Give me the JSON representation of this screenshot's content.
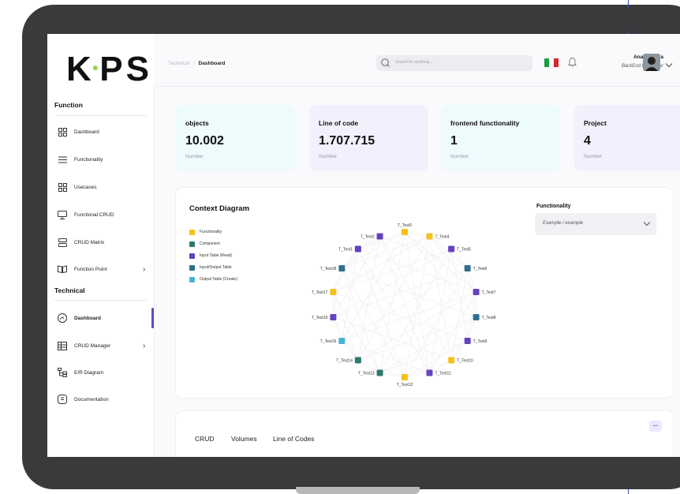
{
  "app": {
    "logo": "KPS"
  },
  "breadcrumb": {
    "parent": "Technical",
    "separator": "/",
    "current": "Dashboard"
  },
  "search": {
    "placeholder": "Search for anything..."
  },
  "user": {
    "name": "Anahita Aria",
    "role": "BackEnd Developer"
  },
  "sidebar": {
    "function_title": "Function",
    "function_items": [
      {
        "label": "Dashboard",
        "icon": "grid-icon"
      },
      {
        "label": "Functionality",
        "icon": "lines-icon"
      },
      {
        "label": "Usecases",
        "icon": "grid-icon"
      },
      {
        "label": "Functional CRUD",
        "icon": "monitor-icon"
      },
      {
        "label": "CRUD Matrix",
        "icon": "server-icon"
      },
      {
        "label": "Function Point",
        "icon": "book-icon"
      }
    ],
    "technical_title": "Technical",
    "technical_items": [
      {
        "label": "Dashboard",
        "icon": "gauge-icon",
        "active": true
      },
      {
        "label": "CRUD Manager",
        "icon": "table-icon"
      },
      {
        "label": "E/R Diagram",
        "icon": "er-icon"
      },
      {
        "label": "Documentation",
        "icon": "doc-icon"
      }
    ]
  },
  "stats": [
    {
      "title": "objects",
      "value": "10.002",
      "unit": "Number",
      "color": "#eefbfd"
    },
    {
      "title": "Line of code",
      "value": "1.707.715",
      "unit": "Number",
      "color": "#f1f0fc"
    },
    {
      "title": "frontend functionality",
      "value": "1",
      "unit": "Number",
      "color": "#eefbfd"
    },
    {
      "title": "Project",
      "value": "4",
      "unit": "Number",
      "color": "#f1f0fc"
    }
  ],
  "diagram": {
    "title": "Context Diagram",
    "legend": [
      {
        "label": "Functionality",
        "color": "#f5c018"
      },
      {
        "label": "Component",
        "color": "#2e7a6e"
      },
      {
        "label": "Input Table (Read)",
        "color": "#6542c0"
      },
      {
        "label": "Input/Output Table",
        "color": "#2f6f8f"
      },
      {
        "label": "Output Table (Create)",
        "color": "#45b4d4"
      }
    ],
    "nodes": [
      {
        "label": "T_Test3",
        "type": 0
      },
      {
        "label": "T_Test4",
        "type": 0
      },
      {
        "label": "T_Test5",
        "type": 2
      },
      {
        "label": "T_Test6",
        "type": 3
      },
      {
        "label": "T_Test7",
        "type": 2
      },
      {
        "label": "T_Test8",
        "type": 3
      },
      {
        "label": "T_Test9",
        "type": 2
      },
      {
        "label": "T_Test10",
        "type": 0
      },
      {
        "label": "T_Test11",
        "type": 2
      },
      {
        "label": "T_Test12",
        "type": 0
      },
      {
        "label": "T_Test13",
        "type": 1
      },
      {
        "label": "T_Test14",
        "type": 1
      },
      {
        "label": "T_Test15",
        "type": 4
      },
      {
        "label": "T_Test16",
        "type": 2
      },
      {
        "label": "T_Test17",
        "type": 0
      },
      {
        "label": "T_Test18",
        "type": 3
      },
      {
        "label": "T_Test1",
        "type": 2
      },
      {
        "label": "T_Test2",
        "type": 2
      }
    ]
  },
  "functionality": {
    "title": "Functionality",
    "selected": "Example / example"
  },
  "bottom_tabs": [
    "CRUD",
    "Volumes",
    "Line of Codes"
  ],
  "more_label": "..."
}
